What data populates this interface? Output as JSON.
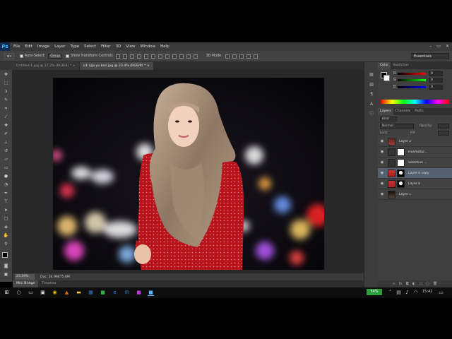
{
  "app": {
    "logo": "Ps"
  },
  "menubar": {
    "items": [
      "File",
      "Edit",
      "Image",
      "Layer",
      "Type",
      "Select",
      "Filter",
      "3D",
      "View",
      "Window",
      "Help"
    ],
    "window_controls": [
      "–",
      "▭",
      "✕"
    ]
  },
  "options": {
    "auto_select_label": "Auto-Select:",
    "auto_select_value": "Group",
    "show_transform_label": "Show Transform Controls",
    "mode_3d_label": "3D Mode:",
    "workspace": "Essentials"
  },
  "doc_tabs": [
    {
      "label": "Untitled-1.jpg @ 17.2% (RGB/8) *  ×",
      "active": false
    },
    {
      "label": "cik ajja yo ban.jpg @ 23.4% (RGB/8) *  ×",
      "active": true
    }
  ],
  "status": {
    "zoom": "23.39%",
    "doc": "Doc: 24.9M/75.6M"
  },
  "bottom_tabs": [
    {
      "label": "Mini Bridge",
      "active": true
    },
    {
      "label": "Timeline",
      "active": false
    }
  ],
  "color_panel": {
    "tabs": [
      {
        "label": "Color",
        "active": true
      },
      {
        "label": "Swatches",
        "active": false
      }
    ],
    "sliders": [
      {
        "letter": "R",
        "value": "0",
        "color_a": "#000000",
        "color_b": "#ff0000"
      },
      {
        "letter": "G",
        "value": "0",
        "color_a": "#000000",
        "color_b": "#00ff00"
      },
      {
        "letter": "B",
        "value": "0",
        "color_a": "#000000",
        "color_b": "#0000ff"
      }
    ]
  },
  "layers_panel": {
    "tabs": [
      {
        "label": "Layers",
        "active": true
      },
      {
        "label": "Channels",
        "active": false
      },
      {
        "label": "Paths",
        "active": false
      }
    ],
    "kind_label": "Kind",
    "blend_mode": "Normal",
    "opacity_label": "Opacity:",
    "lock_label": "Lock:",
    "fill_label": "Fill:",
    "layers": [
      {
        "name": "Layer 2",
        "type": "photo",
        "selected": false
      },
      {
        "name": "Hue/Satur...",
        "type": "adjustment",
        "selected": false
      },
      {
        "name": "Selective ...",
        "type": "adjustment",
        "selected": false
      },
      {
        "name": "Layer 0 copy",
        "type": "masked",
        "selected": true
      },
      {
        "name": "Layer 0",
        "type": "masked",
        "selected": false
      },
      {
        "name": "Layer 1",
        "type": "photo",
        "selected": false
      }
    ]
  },
  "taskbar": {
    "battery": "54%",
    "time": "15:42"
  }
}
